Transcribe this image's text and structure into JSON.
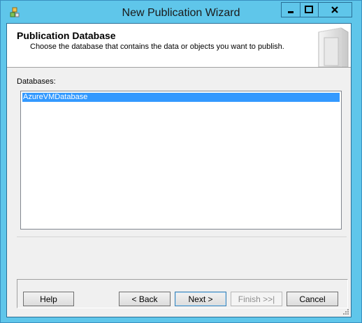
{
  "window": {
    "title": "New Publication Wizard"
  },
  "header": {
    "title": "Publication Database",
    "subtitle": "Choose the database that contains the data or objects you want to publish."
  },
  "databases": {
    "label": "Databases:",
    "items": [
      "AzureVMDatabase"
    ],
    "selected": "AzureVMDatabase"
  },
  "buttons": {
    "help": "Help",
    "back": "< Back",
    "next": "Next >",
    "finish": "Finish >>|",
    "cancel": "Cancel"
  },
  "colors": {
    "title_bar": "#5fc6ea",
    "selection": "#3399ff"
  }
}
